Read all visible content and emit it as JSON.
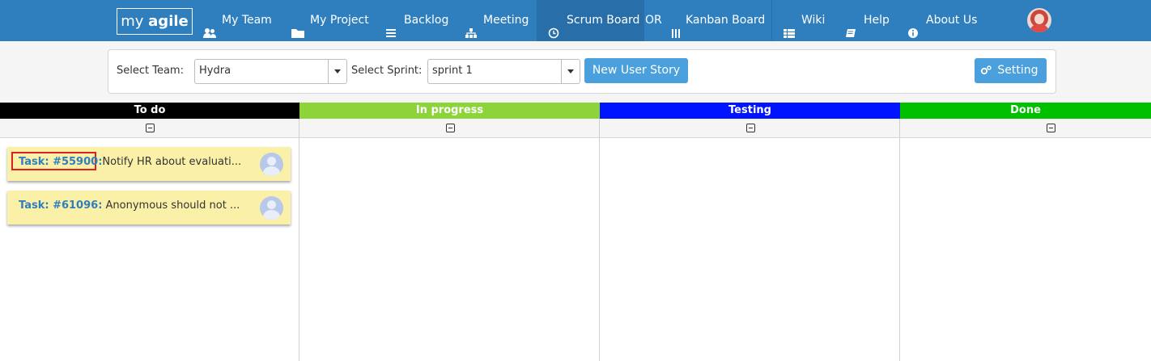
{
  "navbar": {
    "logo": {
      "light": "my ",
      "bold": "agile"
    },
    "items": [
      {
        "label": "My Team",
        "icon": "users-icon"
      },
      {
        "label": "My Project",
        "icon": "folder-icon"
      },
      {
        "label": "Backlog",
        "icon": "list-icon"
      },
      {
        "label": "Meeting",
        "icon": "sitemap-icon"
      },
      {
        "label": "Scrum Board",
        "icon": "clock-icon"
      },
      {
        "label": "OR"
      },
      {
        "label": "Kanban Board",
        "icon": "columns-icon"
      },
      {
        "label": "Wiki",
        "icon": "table-list-icon"
      },
      {
        "label": "Help",
        "icon": "book-icon"
      },
      {
        "label": "About Us",
        "icon": "info-circle-icon"
      }
    ],
    "colors": {
      "bar": "#2f7fbf",
      "active": "#286ea8"
    }
  },
  "filters": {
    "team_label": "Select Team:",
    "team_value": "Hydra",
    "sprint_label": "Select Sprint:",
    "sprint_value": "sprint 1",
    "new_story_button": "New User Story",
    "setting_button": "Setting"
  },
  "board": {
    "columns": [
      {
        "title": "To do",
        "color": "#000000"
      },
      {
        "title": "In progress",
        "color": "#8dd43b"
      },
      {
        "title": "Testing",
        "color": "#0014ff"
      },
      {
        "title": "Done",
        "color": "#00c000"
      }
    ],
    "todo_cards": [
      {
        "id": "Task: #55900:",
        "text": "Notify HR about evaluati..."
      },
      {
        "id": "Task: #61096:",
        "text": "Anonymous should not ..."
      }
    ]
  }
}
